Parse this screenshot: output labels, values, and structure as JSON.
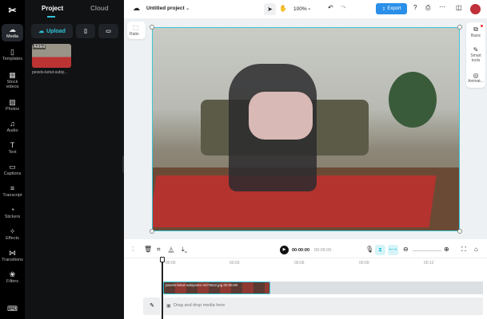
{
  "rail": {
    "items": [
      {
        "label": "Media",
        "icon": "cloud-media-icon",
        "active": true
      },
      {
        "label": "Templates",
        "icon": "templates-icon"
      },
      {
        "label": "Stock videos",
        "icon": "film-icon"
      },
      {
        "label": "Photos",
        "icon": "photo-icon"
      },
      {
        "label": "Audio",
        "icon": "music-icon"
      },
      {
        "label": "Text",
        "icon": "text-icon"
      },
      {
        "label": "Captions",
        "icon": "captions-icon"
      },
      {
        "label": "Transcript",
        "icon": "transcript-icon"
      },
      {
        "label": "Stickers",
        "icon": "sticker-icon"
      },
      {
        "label": "Effects",
        "icon": "sparkle-icon"
      },
      {
        "label": "Transitions",
        "icon": "transition-icon"
      },
      {
        "label": "Filters",
        "icon": "filters-icon"
      }
    ]
  },
  "panel": {
    "tabs": [
      "Project",
      "Cloud"
    ],
    "upload_label": "Upload",
    "media": [
      {
        "badge": "Added",
        "name": "pexels-ketut-subiy..."
      }
    ]
  },
  "header": {
    "project_title": "Untitled project",
    "zoom": "100%",
    "export_label": "Export"
  },
  "canvas": {
    "ratio_label": "Ratio",
    "side_tools": [
      "Basic",
      "Smart tools",
      "Animat..."
    ]
  },
  "timeline": {
    "current_time": "00:00:00",
    "duration": "00:05:00",
    "ticks": [
      "00:00",
      "00:03",
      "00:06",
      "00:09",
      "00:12"
    ],
    "clip_label": "pexels-ketut-subiyanto-4473612.jpg  00:05:00",
    "drop_hint": "Drag and drop media here"
  },
  "colors": {
    "accent": "#2fc3d8",
    "export": "#2a8fe8"
  }
}
